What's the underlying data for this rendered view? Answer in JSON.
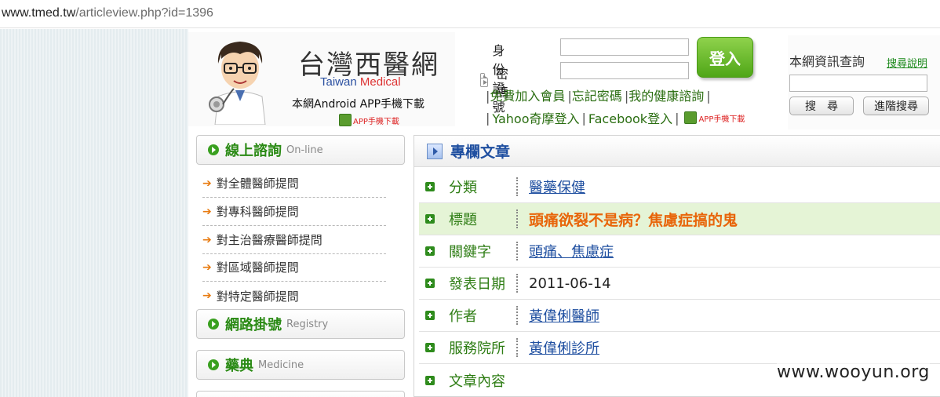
{
  "browser": {
    "url_host": "www.tmed.tw",
    "url_rest": "/articleview.php?id=1396"
  },
  "header": {
    "site_title": "台灣西醫網",
    "site_sub_1": "Taiwan ",
    "site_sub_2": "Medical",
    "app_text": "本網Android APP手機下載",
    "app_badge": "APP手機下載"
  },
  "login": {
    "id_label": "身份證號",
    "password_label": "密　　碼",
    "login_button": "登入",
    "links_row1": [
      "免費加入會員",
      "忘記密碼",
      "我的健康諮詢"
    ],
    "links_row2": [
      "Yahoo奇摩登入",
      "Facebook登入"
    ],
    "app_badge": "APP手機下載"
  },
  "search": {
    "title": "本網資訊查詢",
    "help_link": "搜尋說明",
    "search_button": "搜　尋",
    "advanced_button": "進階搜尋"
  },
  "sidebar": {
    "online": {
      "zh": "線上諮詢",
      "en": "On-line"
    },
    "items": [
      "對全體醫師提問",
      "對專科醫師提問",
      "對主治醫療醫師提問",
      "對區域醫師提問",
      "對特定醫師提問"
    ],
    "registry": {
      "zh": "網路掛號",
      "en": "Registry"
    },
    "medicine": {
      "zh": "藥典",
      "en": "Medicine"
    }
  },
  "article": {
    "panel_title": "專欄文章",
    "rows": [
      {
        "label": "分類",
        "value": "醫藥保健"
      },
      {
        "label": "標題",
        "value": "頭痛欲裂不是病？焦慮症搞的鬼"
      },
      {
        "label": "關鍵字",
        "value": "頭痛、焦慮症"
      },
      {
        "label": "發表日期",
        "value": "2011-06-14"
      },
      {
        "label": "作者",
        "value": "黃偉俐醫師"
      },
      {
        "label": "服務院所",
        "value": "黃偉俐診所"
      },
      {
        "label": "文章內容",
        "value": ""
      }
    ]
  },
  "watermark": "www.wooyun.org",
  "colors": {
    "accent_green": "#2e8b1c",
    "title_orange": "#e8650a",
    "link_blue": "#1f4fa0"
  }
}
